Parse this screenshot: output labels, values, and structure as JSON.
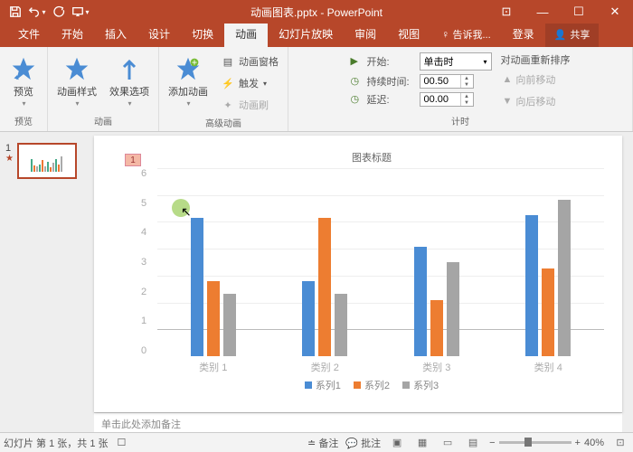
{
  "titlebar": {
    "title": "动画图表.pptx - PowerPoint"
  },
  "tabs": {
    "file": "文件",
    "home": "开始",
    "insert": "插入",
    "design": "设计",
    "transitions": "切换",
    "animations": "动画",
    "slideshow": "幻灯片放映",
    "review": "审阅",
    "view": "视图",
    "tellme": "告诉我...",
    "signin": "登录",
    "share": "共享"
  },
  "ribbon": {
    "preview": {
      "btn": "预览",
      "group": "预览"
    },
    "anim": {
      "styles": "动画样式",
      "effectopts": "效果选项",
      "group": "动画"
    },
    "adv": {
      "add": "添加动画",
      "pane": "动画窗格",
      "trigger": "触发",
      "painter": "动画刷",
      "group": "高级动画"
    },
    "timing": {
      "start_lbl": "开始:",
      "start_val": "单击时",
      "dur_lbl": "持续时间:",
      "dur_val": "00.50",
      "delay_lbl": "延迟:",
      "delay_val": "00.00",
      "group": "计时"
    },
    "reorder": {
      "hd": "对动画重新排序",
      "fwd": "向前移动",
      "back": "向后移动"
    }
  },
  "thumb": {
    "num": "1"
  },
  "marker": "1",
  "chart_data": {
    "type": "bar",
    "title": "图表标题",
    "categories": [
      "类别 1",
      "类别 2",
      "类别 3",
      "类别 4"
    ],
    "series": [
      {
        "name": "系列1",
        "color": "#4a8cd4",
        "values": [
          4.4,
          2.4,
          3.5,
          4.5
        ]
      },
      {
        "name": "系列2",
        "color": "#ed7d31",
        "values": [
          2.4,
          4.4,
          1.8,
          2.8
        ]
      },
      {
        "name": "系列3",
        "color": "#a5a5a5",
        "values": [
          2.0,
          2.0,
          3.0,
          5.0
        ]
      }
    ],
    "yticks": [
      0,
      1,
      2,
      3,
      4,
      5,
      6
    ],
    "ylim": [
      0,
      6
    ]
  },
  "notes": "单击此处添加备注",
  "status": {
    "slide": "幻灯片 第 1 张，共 1 张",
    "notes": "备注",
    "comments": "批注",
    "zoom": "40%"
  }
}
